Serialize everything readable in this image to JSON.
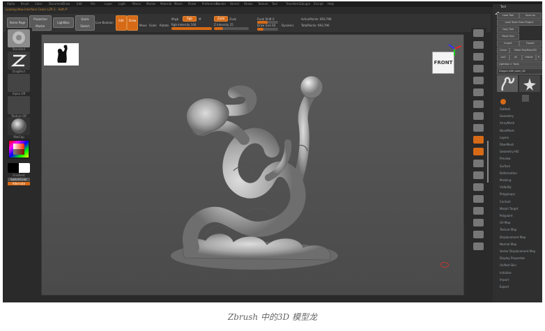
{
  "app": {
    "title_line": "Loading New Interface Colors  LZR  3 - Seth P",
    "menu": [
      "Alpha",
      "Brush",
      "Color",
      "Document",
      "Draw",
      "Edit",
      "File",
      "Layer",
      "Light",
      "Macro",
      "Marker",
      "Material",
      "Movie",
      "Picker",
      "Preferences",
      "Render",
      "Stencil",
      "Stroke",
      "Texture",
      "Tool",
      "Transform",
      "Zplugin",
      "Zscript",
      "Help"
    ],
    "tool_title": "Tool"
  },
  "toolbar": {
    "home_page": "Home Page",
    "projection_master": "Projection Master",
    "lightbox": "LightBox",
    "quick_sketch": "Quick Sketch",
    "live_boolean": "Live Boolean",
    "edit": "Edit",
    "draw": "Draw",
    "move": "Move",
    "scale": "Scale",
    "rotate": "Rotate",
    "mrgb": "Mrgb",
    "rgb": "Rgb",
    "m": "M",
    "rgb_intensity": "Rgb Intensity 100",
    "zadd": "Zadd",
    "zsub": "Zsub",
    "z_intensity": "Z Intensity 25",
    "focal_shift": "Focal Shift 0",
    "draw_size": "Draw Size 64",
    "dynamic": "Dynamic",
    "active_points": "ActivePoints: 693,796",
    "total_points": "TotalPoints: 693,796"
  },
  "left": {
    "brush_label": "Standard",
    "stroke_label": "DragRect",
    "alpha_label": "Alpha Off",
    "texture_label": "Texture Off",
    "material_label": "MatCap",
    "gradient_label": "Gradient",
    "switch_color": "SwitchColor",
    "alternate": "Alternate"
  },
  "viewport": {
    "front_label": "FRONT"
  },
  "right_icons": [
    "BPR",
    "SPix 3",
    "Scroll",
    "Zoom",
    "Actual",
    "AAHalf",
    "Persp",
    "Floor",
    "Local",
    "L.Sym",
    "Frame",
    "Move",
    "Scale",
    "Rotate",
    "Line Fill PolyF",
    "Transp",
    "Ghost",
    "Solo",
    "Xpose"
  ],
  "panel": {
    "load_tool": "Load Tool",
    "save_as": "Save As",
    "load_tools_from_project": "Load Tools From Project",
    "copy_tool": "Copy Tool",
    "paste_tool": "Paste Tool",
    "import": "Import",
    "export": "Export",
    "clone": "Clone",
    "make_polymesh3d": "Make PolyMesh3D",
    "goz": "GoZ",
    "all": "All",
    "visible": "Visible",
    "r": "R",
    "lightbox_tools": "Lightbox > Tools",
    "current_tool": "Dragon with pearl_48",
    "sections": [
      "Subtool",
      "Geometry",
      "ArrayMesh",
      "NanoMesh",
      "Layers",
      "FiberMesh",
      "Geometry HD",
      "Preview",
      "Surface",
      "Deformation",
      "Masking",
      "Visibility",
      "Polygroups",
      "Contact",
      "Morph Target",
      "Polypaint",
      "UV Map",
      "Texture Map",
      "Displacement Map",
      "Normal Map",
      "Vector Displacement Map",
      "Display Properties",
      "Unified Skin",
      "Initialize",
      "Import",
      "Export"
    ]
  },
  "caption": "Zbrush 中的3D 模型龙"
}
